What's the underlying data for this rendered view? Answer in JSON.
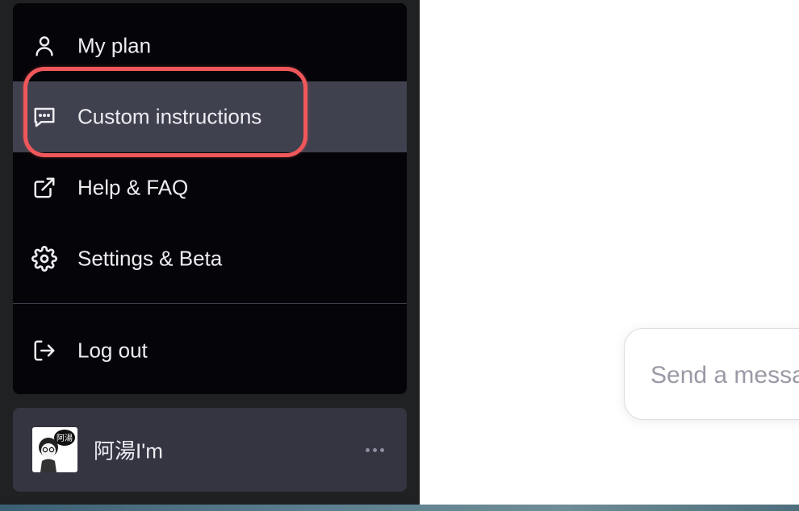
{
  "menu": {
    "items": [
      {
        "label": "My plan",
        "icon": "user-icon"
      },
      {
        "label": "Custom instructions",
        "icon": "chat-bubble-icon"
      },
      {
        "label": "Help & FAQ",
        "icon": "external-link-icon"
      },
      {
        "label": "Settings & Beta",
        "icon": "gear-icon"
      }
    ],
    "logout": {
      "label": "Log out",
      "icon": "logout-icon"
    }
  },
  "user": {
    "name": "阿湯I'm",
    "avatar_text": "阿湯",
    "more_icon": "more-horizontal-icon"
  },
  "composer": {
    "placeholder": "Send a message"
  },
  "colors": {
    "sidebar_bg": "#202123",
    "menu_bg": "#050509",
    "active_item_bg": "#40414f",
    "user_bar_bg": "#343541",
    "highlight": "#f0575a",
    "text": "#ececf1"
  }
}
